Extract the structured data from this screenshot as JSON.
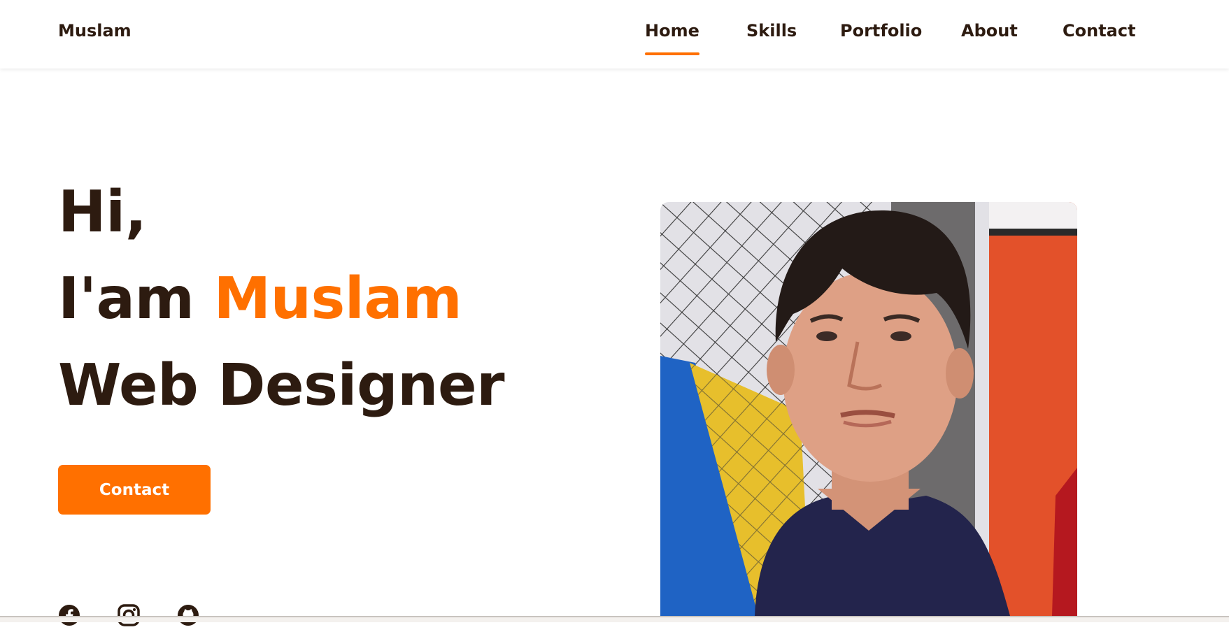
{
  "brand": "Muslam",
  "nav": {
    "items": [
      {
        "label": "Home",
        "active": true
      },
      {
        "label": "Skills",
        "active": false
      },
      {
        "label": "Portfolio",
        "active": false
      },
      {
        "label": "About",
        "active": false
      },
      {
        "label": "Contact",
        "active": false
      }
    ]
  },
  "hero": {
    "greeting": "Hi,",
    "intro_prefix": "I'am",
    "name": "Muslam",
    "role": "Web Designer",
    "cta_label": "Contact"
  },
  "social": {
    "icons": [
      "facebook-icon",
      "instagram-icon",
      "github-icon"
    ]
  },
  "portrait": {
    "description_icon": "profile-photo"
  },
  "colors": {
    "accent": "#ff7000",
    "text_dark": "#2d1b10",
    "background": "#ffffff"
  }
}
